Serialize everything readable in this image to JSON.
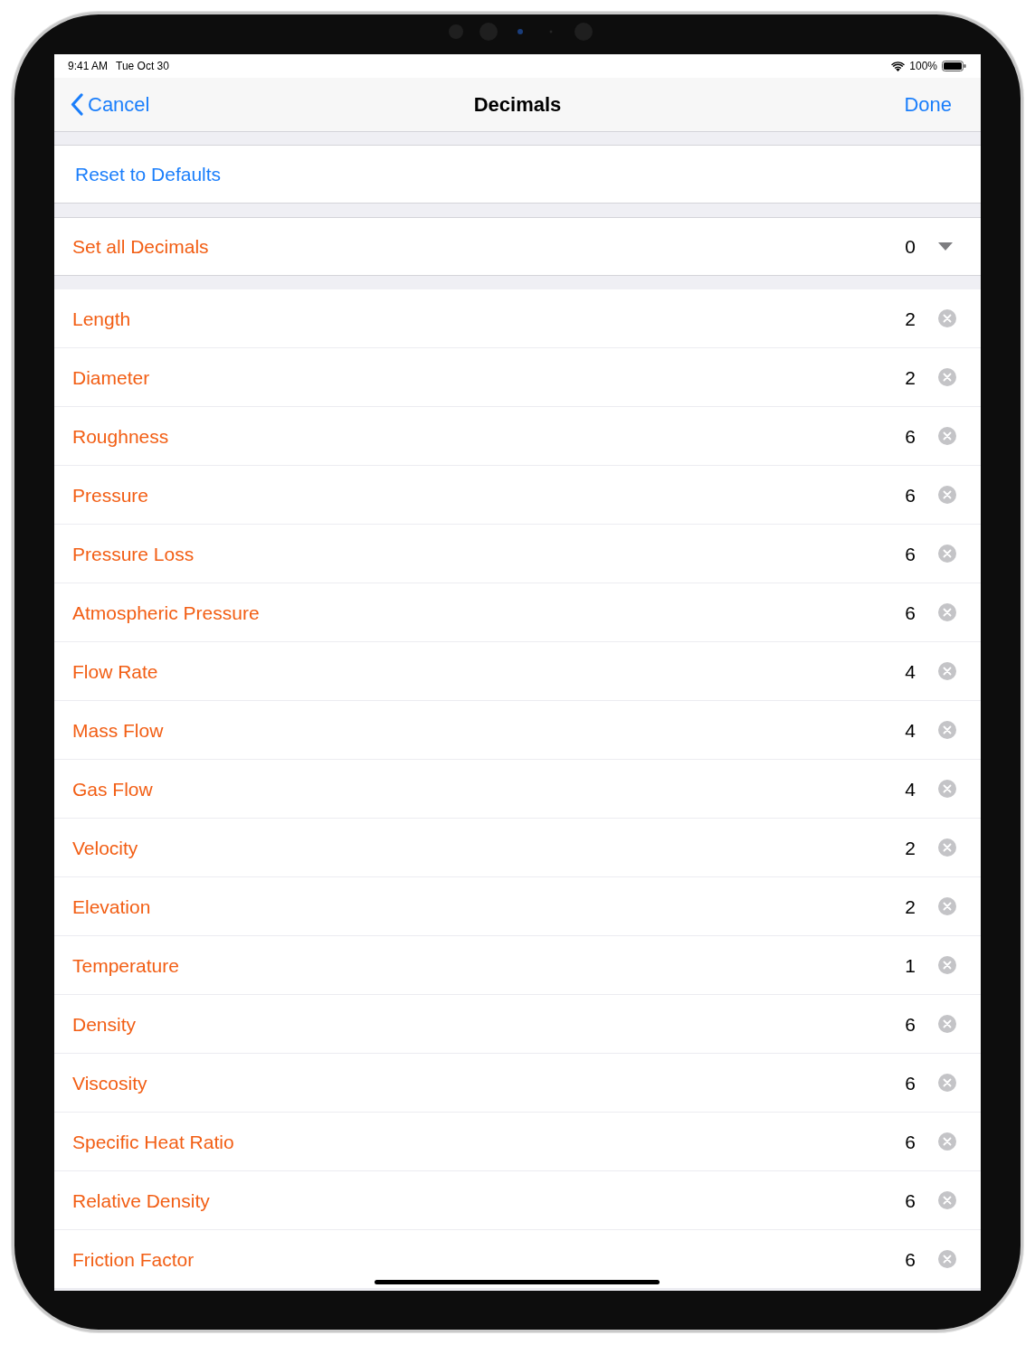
{
  "status_bar": {
    "time": "9:41 AM",
    "date": "Tue Oct 30",
    "battery": "100%"
  },
  "nav_bar": {
    "back": "Cancel",
    "title": "Decimals",
    "done": "Done"
  },
  "reset": {
    "label": "Reset to Defaults"
  },
  "set_all": {
    "label": "Set all Decimals",
    "value": "0"
  },
  "rows": [
    {
      "label": "Length",
      "value": "2"
    },
    {
      "label": "Diameter",
      "value": "2"
    },
    {
      "label": "Roughness",
      "value": "6"
    },
    {
      "label": "Pressure",
      "value": "6"
    },
    {
      "label": "Pressure Loss",
      "value": "6"
    },
    {
      "label": "Atmospheric Pressure",
      "value": "6"
    },
    {
      "label": "Flow Rate",
      "value": "4"
    },
    {
      "label": "Mass Flow",
      "value": "4"
    },
    {
      "label": "Gas Flow",
      "value": "4"
    },
    {
      "label": "Velocity",
      "value": "2"
    },
    {
      "label": "Elevation",
      "value": "2"
    },
    {
      "label": "Temperature",
      "value": "1"
    },
    {
      "label": "Density",
      "value": "6"
    },
    {
      "label": "Viscosity",
      "value": "6"
    },
    {
      "label": "Specific Heat Ratio",
      "value": "6"
    },
    {
      "label": "Relative Density",
      "value": "6"
    },
    {
      "label": "Friction Factor",
      "value": "6"
    }
  ]
}
